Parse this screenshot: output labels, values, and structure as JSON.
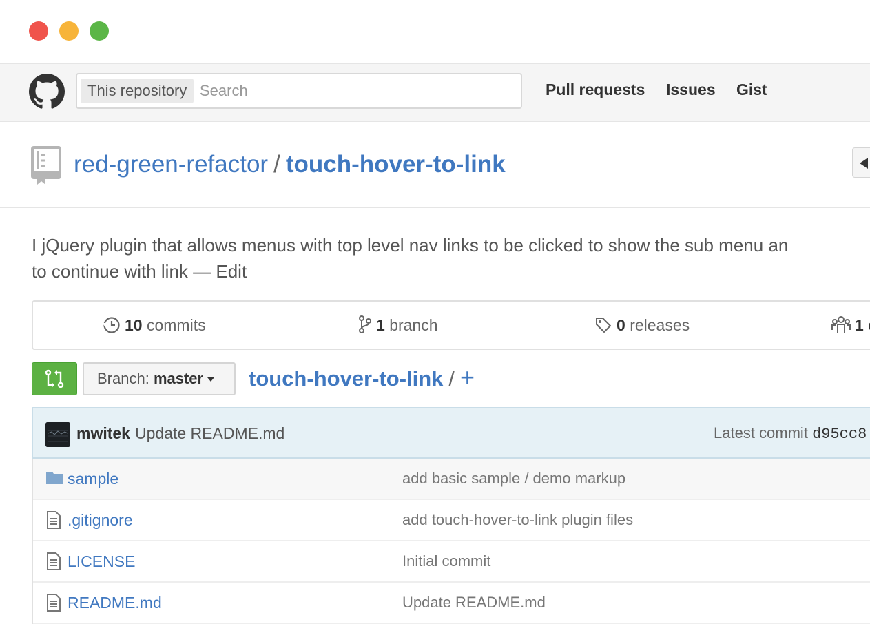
{
  "header": {
    "search_scope": "This repository",
    "search_placeholder": "Search",
    "nav": [
      "Pull requests",
      "Issues",
      "Gist"
    ]
  },
  "repo": {
    "owner": "red-green-refactor",
    "separator": "/",
    "name": "touch-hover-to-link",
    "description": "I jQuery plugin that allows menus with top level nav links to be clicked to show the sub menu an",
    "description_line2": "to continue with link",
    "edit_dash": "—",
    "edit_label": "Edit"
  },
  "summary": {
    "commits_count": "10",
    "commits_label": "commits",
    "branches_count": "1",
    "branches_label": "branch",
    "releases_count": "0",
    "releases_label": "releases",
    "contributors_count": "1 c"
  },
  "file_nav": {
    "branch_prefix": "Branch:",
    "branch_name": "master",
    "breadcrumb_repo": "touch-hover-to-link",
    "breadcrumb_sep": "/",
    "add_file": "+"
  },
  "commit": {
    "author": "mwitek",
    "message": "Update README.md",
    "latest_label": "Latest commit",
    "sha": "d95cc8"
  },
  "files": [
    {
      "icon": "folder-icon",
      "name": "sample",
      "message": "add basic sample / demo markup"
    },
    {
      "icon": "file-icon",
      "name": ".gitignore",
      "message": "add touch-hover-to-link plugin files"
    },
    {
      "icon": "file-icon",
      "name": "LICENSE",
      "message": "Initial commit"
    },
    {
      "icon": "file-icon",
      "name": "README.md",
      "message": "Update README.md"
    }
  ],
  "colors": {
    "link": "#4078c0",
    "compare_button": "#5cb143",
    "commit_tease_bg": "#e6f1f6",
    "close_dot": "#f0544c",
    "minimize_dot": "#f7b43a",
    "zoom_dot": "#5bb647"
  }
}
